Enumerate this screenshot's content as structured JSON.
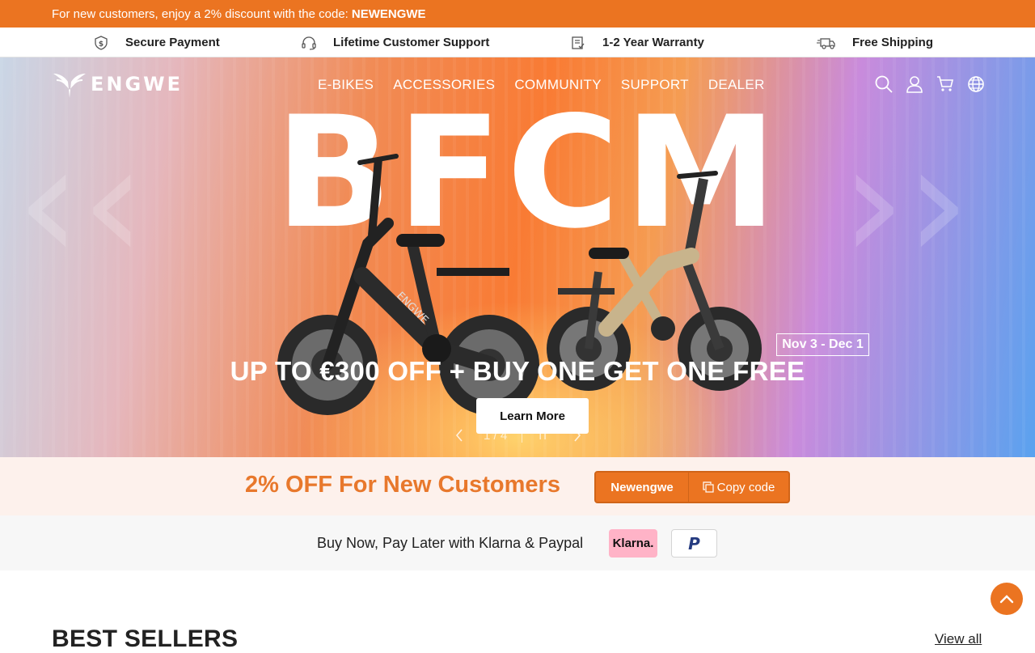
{
  "announcement": {
    "text": "For new customers, enjoy a 2% discount with the code:",
    "code": "NEWENGWE"
  },
  "features": [
    {
      "icon": "shield-dollar-icon",
      "label": "Secure Payment"
    },
    {
      "icon": "headset-icon",
      "label": "Lifetime Customer Support"
    },
    {
      "icon": "warranty-doc-icon",
      "label": "1-2 Year Warranty"
    },
    {
      "icon": "truck-icon",
      "label": "Free Shipping"
    }
  ],
  "header": {
    "logo_text": "ENGWE",
    "menu": [
      "E-BIKES",
      "ACCESSORIES",
      "COMMUNITY",
      "SUPPORT",
      "DEALER"
    ],
    "icons": [
      "search-icon",
      "account-icon",
      "cart-icon",
      "globe-icon"
    ]
  },
  "hero": {
    "big_text": "BFCM",
    "date_badge": "Nov 3 - Dec 1",
    "headline": "UP TO €300 OFF + BUY ONE GET ONE FREE",
    "cta": "Learn More",
    "slide_counter": "1 / 4",
    "pause_label": "II",
    "bike_brand": "ENGWE"
  },
  "promo": {
    "title": "2% OFF For New Customers",
    "code": "Newengwe",
    "copy_label": "Copy code"
  },
  "payment": {
    "text": "Buy Now, Pay Later with Klarna & Paypal",
    "klarna": "Klarna.",
    "paypal": "P"
  },
  "section": {
    "title": "BEST SELLERS",
    "view_all": "View all"
  },
  "colors": {
    "brand_orange": "#eb7421",
    "promo_bg": "#fdf1ec",
    "klarna_pink": "#ffb3c7"
  }
}
